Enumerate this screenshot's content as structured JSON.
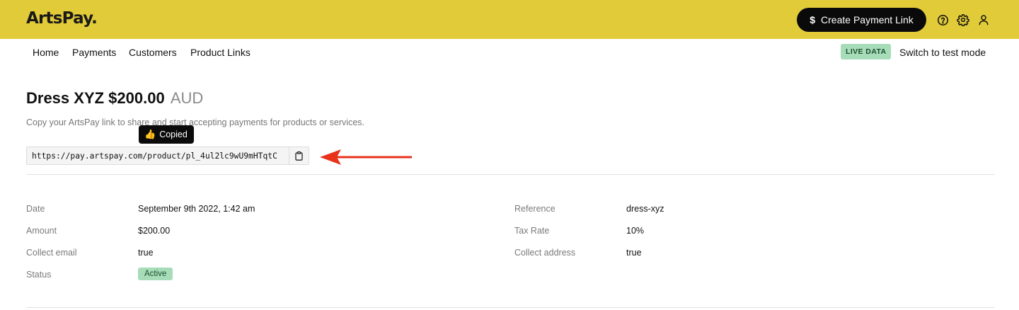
{
  "header": {
    "logo": "ArtsPay.",
    "create_button": {
      "icon": "$",
      "label": "Create Payment Link"
    },
    "icons": [
      "help-icon",
      "gear-icon",
      "user-icon"
    ]
  },
  "nav": {
    "items": [
      {
        "label": "Home"
      },
      {
        "label": "Payments"
      },
      {
        "label": "Customers"
      },
      {
        "label": "Product Links"
      }
    ],
    "live_badge": "LIVE DATA",
    "switch_mode": "Switch to test mode"
  },
  "product": {
    "title": "Dress XYZ $200.00",
    "currency": "AUD",
    "subtitle": "Copy your ArtsPay link to share and start accepting payments for products or services.",
    "tooltip": {
      "icon": "👍",
      "label": "Copied"
    },
    "link": "https://pay.artspay.com/product/pl_4ul2lc9wU9mHTqtC"
  },
  "details": {
    "left": [
      {
        "label": "Date",
        "value": "September 9th 2022, 1:42 am"
      },
      {
        "label": "Amount",
        "value": "$200.00"
      },
      {
        "label": "Collect email",
        "value": "true"
      },
      {
        "label": "Status",
        "value": "Active"
      }
    ],
    "right": [
      {
        "label": "Reference",
        "value": "dress-xyz"
      },
      {
        "label": "Tax Rate",
        "value": "10%"
      },
      {
        "label": "Collect address",
        "value": "true"
      }
    ]
  },
  "colors": {
    "header_bg": "#e2cb38",
    "badge_green": "#a7dcb8",
    "arrow_red": "#e8321c"
  }
}
